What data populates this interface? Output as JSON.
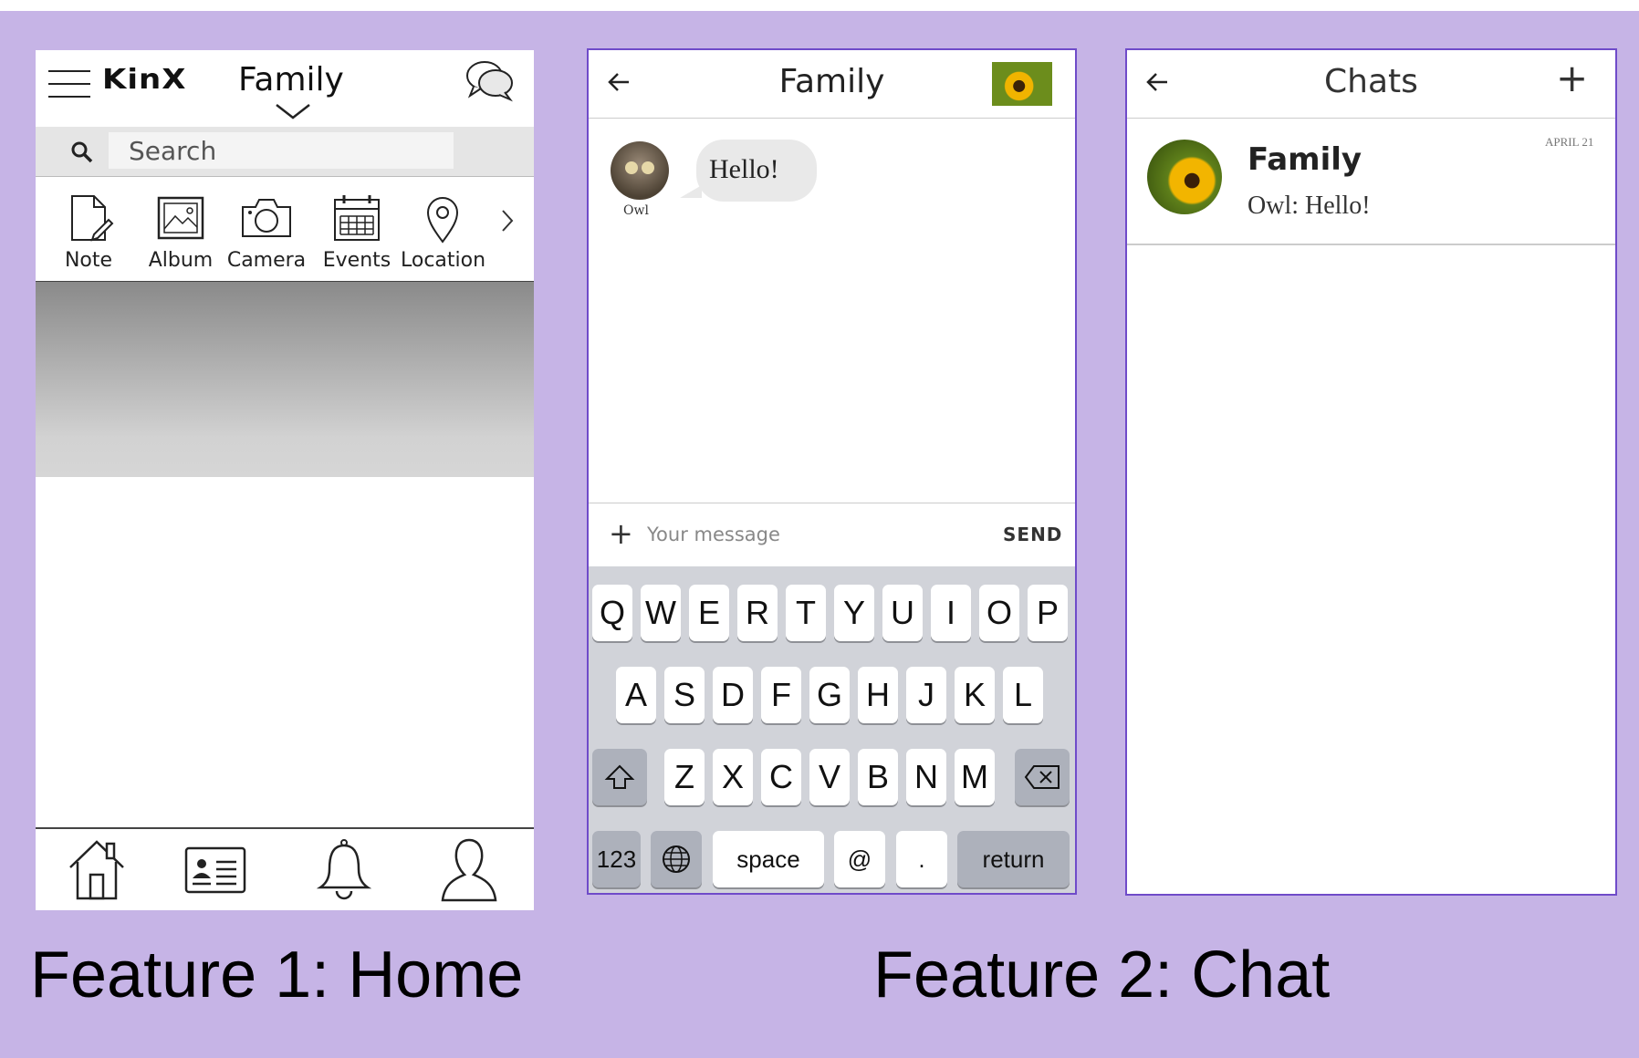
{
  "home": {
    "logo": "KinX",
    "title": "Family",
    "search_placeholder": "Search",
    "actions": [
      {
        "label": "Note",
        "icon": "note-icon"
      },
      {
        "label": "Album",
        "icon": "album-icon"
      },
      {
        "label": "Camera",
        "icon": "camera-icon"
      },
      {
        "label": "Events",
        "icon": "calendar-icon"
      },
      {
        "label": "Location",
        "icon": "location-pin-icon"
      }
    ],
    "bottom_nav": [
      "home-icon",
      "contacts-card-icon",
      "bell-icon",
      "profile-icon"
    ]
  },
  "chat_room": {
    "title": "Family",
    "messages": [
      {
        "sender": "Owl",
        "text": "Hello!"
      }
    ],
    "input_placeholder": "Your message",
    "send_label": "SEND",
    "keyboard": {
      "row1": [
        "Q",
        "W",
        "E",
        "R",
        "T",
        "Y",
        "U",
        "I",
        "O",
        "P"
      ],
      "row2": [
        "A",
        "S",
        "D",
        "F",
        "G",
        "H",
        "J",
        "K",
        "L"
      ],
      "row3": [
        "Z",
        "X",
        "C",
        "V",
        "B",
        "N",
        "M"
      ],
      "numbers_key": "123",
      "space_key": "space",
      "at_key": "@",
      "dot_key": ".",
      "return_key": "return"
    }
  },
  "chat_list": {
    "title": "Chats",
    "add_label": "+",
    "conversations": [
      {
        "name": "Family",
        "last_message": "Owl: Hello!",
        "date": "APRIL 21"
      }
    ]
  },
  "captions": {
    "feature1": "Feature 1: Home",
    "feature2": "Feature 2: Chat"
  },
  "colors": {
    "background": "#c6b4e6",
    "phone_border": "#6f4bc9"
  }
}
